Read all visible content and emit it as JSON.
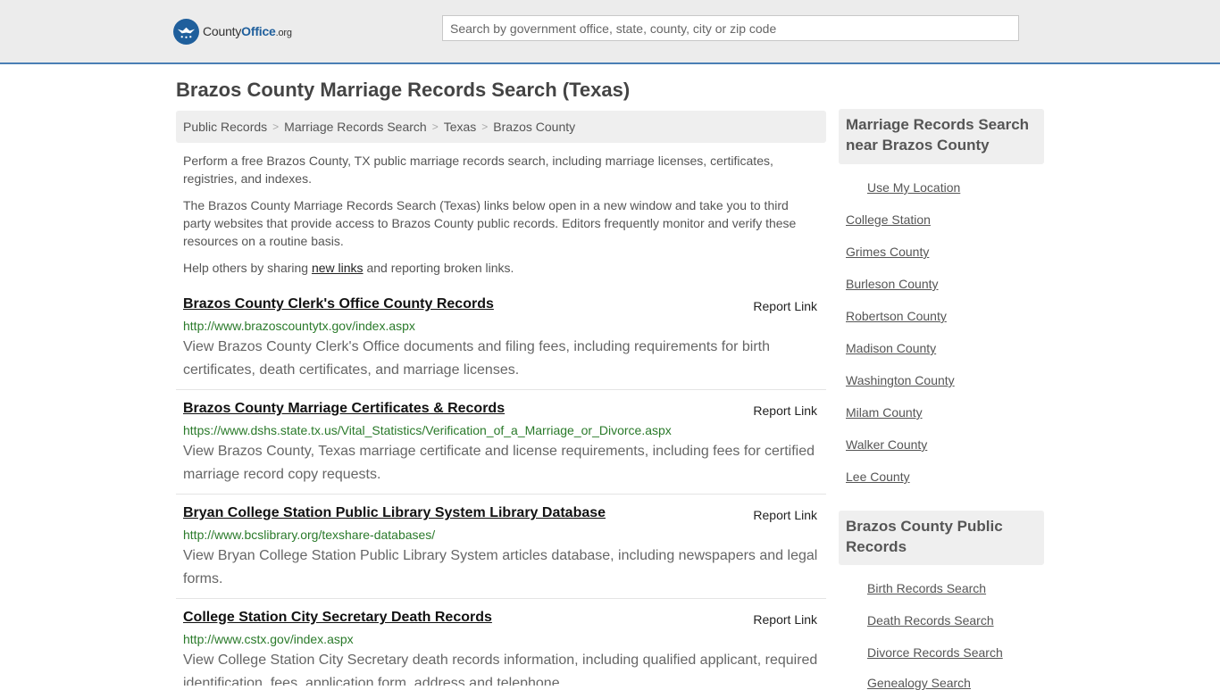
{
  "header": {
    "logo": {
      "part1": "County",
      "part2": "Office",
      "part3": ".org"
    },
    "search_placeholder": "Search by government office, state, county, city or zip code"
  },
  "page_title": "Brazos County Marriage Records Search (Texas)",
  "breadcrumb": [
    "Public Records",
    "Marriage Records Search",
    "Texas",
    "Brazos County"
  ],
  "intro": {
    "p1": "Perform a free Brazos County, TX public marriage records search, including marriage licenses, certificates, registries, and indexes.",
    "p2": "The Brazos County Marriage Records Search (Texas) links below open in a new window and take you to third party websites that provide access to Brazos County public records. Editors frequently monitor and verify these resources on a routine basis.",
    "p3_before": "Help others by sharing ",
    "p3_link": "new links",
    "p3_after": " and reporting broken links."
  },
  "report_label": "Report Link",
  "entries": [
    {
      "title": "Brazos County Clerk's Office County Records",
      "url": "http://www.brazoscountytx.gov/index.aspx",
      "desc": "View Brazos County Clerk's Office documents and filing fees, including requirements for birth certificates, death certificates, and marriage licenses."
    },
    {
      "title": "Brazos County Marriage Certificates & Records",
      "url": "https://www.dshs.state.tx.us/Vital_Statistics/Verification_of_a_Marriage_or_Divorce.aspx",
      "desc": "View Brazos County, Texas marriage certificate and license requirements, including fees for certified marriage record copy requests."
    },
    {
      "title": "Bryan College Station Public Library System Library Database",
      "url": "http://www.bcslibrary.org/texshare-databases/",
      "desc": "View Bryan College Station Public Library System articles database, including newspapers and legal forms."
    },
    {
      "title": "College Station City Secretary Death Records",
      "url": "http://www.cstx.gov/index.aspx",
      "desc": "View College Station City Secretary death records information, including qualified applicant, required identification, fees, application form, address and telephone."
    }
  ],
  "sidebar": {
    "nearby": {
      "heading": "Marriage Records Search near Brazos County",
      "use_location": "Use My Location",
      "items": [
        "College Station",
        "Grimes County",
        "Burleson County",
        "Robertson County",
        "Madison County",
        "Washington County",
        "Milam County",
        "Walker County",
        "Lee County"
      ]
    },
    "public_records": {
      "heading": "Brazos County Public Records",
      "items": [
        "Birth Records Search",
        "Death Records Search",
        "Divorce Records Search",
        "Genealogy Search"
      ]
    }
  },
  "colors": {
    "accent": "#1f5f9c",
    "url_green": "#2a7a2a",
    "header_border": "#4a7fb5"
  }
}
